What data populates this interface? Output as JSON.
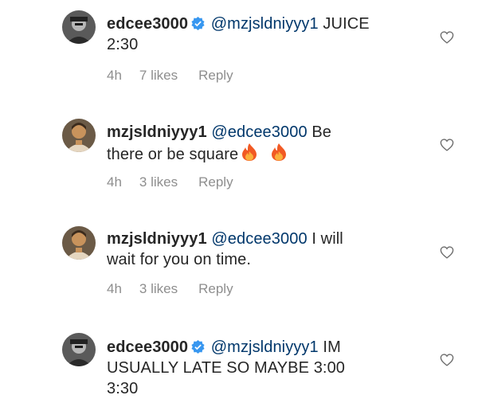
{
  "comments": [
    {
      "username": "edcee3000",
      "verified": true,
      "mention": "@mzjsldniyyy1",
      "text_line1": "JUICE",
      "text_line2": "2:30",
      "time": "4h",
      "likes": "7 likes",
      "reply": "Reply",
      "avatar": "grayscale-portrait"
    },
    {
      "username": "mzjsldniyyy1",
      "verified": false,
      "mention": "@edcee3000",
      "text_line1": "Be",
      "text_line2": "there or be square",
      "emoji": [
        "fire-emoji",
        "fire-emoji"
      ],
      "time": "4h",
      "likes": "3 likes",
      "reply": "Reply",
      "avatar": "color-portrait"
    },
    {
      "username": "mzjsldniyyy1",
      "verified": false,
      "mention": "@edcee3000",
      "text_line1": "I will",
      "text_line2": "wait for you on time.",
      "time": "4h",
      "likes": "3 likes",
      "reply": "Reply",
      "avatar": "color-portrait"
    },
    {
      "username": "edcee3000",
      "verified": true,
      "mention": "@mzjsldniyyy1",
      "text_line1": "IM",
      "text_line2": "USUALLY LATE SO MAYBE 3:00",
      "text_line3": "3:30",
      "avatar": "grayscale-portrait"
    }
  ],
  "colors": {
    "text": "#262626",
    "meta": "#8e8e8e",
    "mention": "#00376b",
    "verified": "#3897f0"
  },
  "icons": {
    "like": "heart-outline-icon",
    "verified": "verified-badge-icon"
  }
}
